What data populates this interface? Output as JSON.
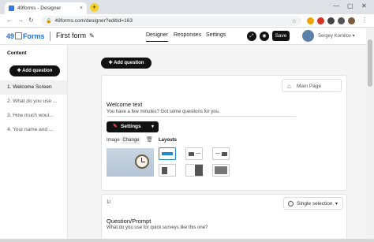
{
  "browser": {
    "tab_title": "49forms - Designer",
    "url": "49forms.com/designer?editId=163",
    "close_glyph": "×",
    "newtab_glyph": "+"
  },
  "header": {
    "logo_left": "49",
    "logo_right": "Forms",
    "form_name": "First form",
    "tabs": [
      {
        "label": "Designer"
      },
      {
        "label": "Responses"
      },
      {
        "label": "Settings"
      }
    ],
    "save_label": "Save",
    "user_name": "Sergey Komilov ▾"
  },
  "sidebar": {
    "title": "Content",
    "add_question": "✚ Add question",
    "items": [
      {
        "label": "1. Welcome Screen"
      },
      {
        "label": "2. What do you use ..."
      },
      {
        "label": "3. How much woul..."
      },
      {
        "label": "4. Your name and ..."
      }
    ]
  },
  "main": {
    "add_question": "✚ Add question",
    "welcome_card": {
      "main_page_label": "Main Page",
      "title": "Welcome text",
      "subtitle": "You have a few minutes? Got some questions for you.",
      "settings_label": "Settings",
      "image_label": "Image",
      "change_label": "Change",
      "layouts_label": "Layouts"
    },
    "question_card": {
      "number": "1/",
      "type_label": "Single selection",
      "title": "Question/Prompt",
      "subtitle": "What do you use for quick surveys like this one?"
    }
  },
  "icons": {
    "edit": "✎",
    "home": "⌂",
    "trash": "🗑",
    "chevron": "▾",
    "back": "←",
    "forward": "→",
    "reload": "↻",
    "lock": "🔒",
    "star": "☆"
  },
  "colors": {
    "accent_blue": "#1e6fd9",
    "logo_green": "#3aa655",
    "button_black": "#111111",
    "layout_selected": "#1e8ad6"
  }
}
